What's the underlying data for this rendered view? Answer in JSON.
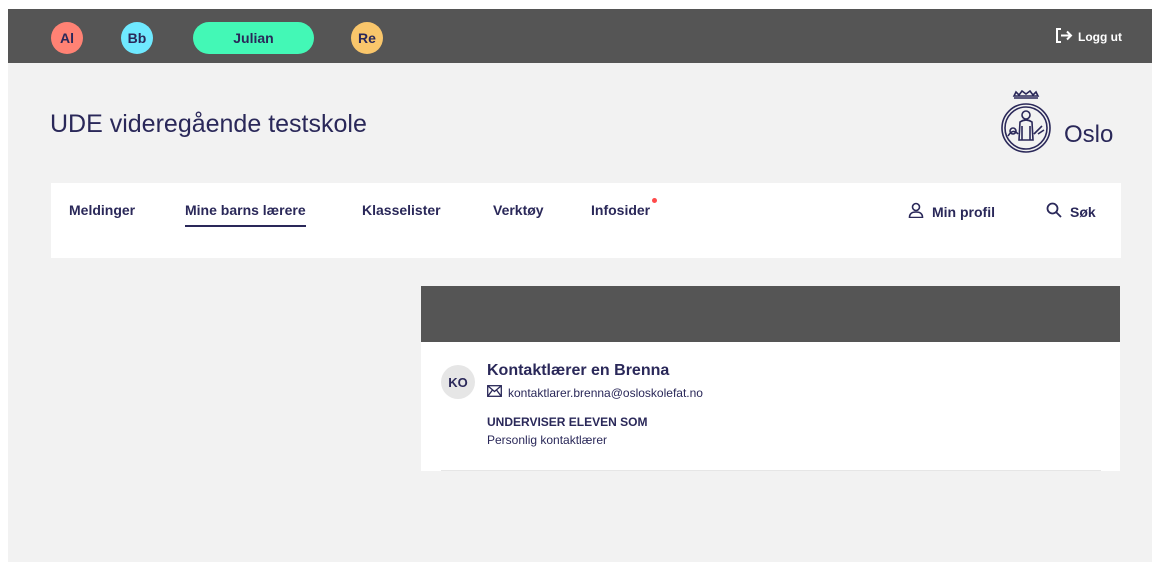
{
  "topbar": {
    "children": [
      {
        "label": "Al",
        "color": "#ff8274"
      },
      {
        "label": "Bb",
        "color": "#6fe9ff"
      },
      {
        "label": "Julian",
        "color": "#43f8b6"
      },
      {
        "label": "Re",
        "color": "#f9c66b"
      }
    ],
    "logout_label": "Logg ut",
    "logout_icon": "logout-icon"
  },
  "header": {
    "title": "UDE videregående testskole",
    "logo_text": "Oslo",
    "logo_icon": "oslo-seal-icon"
  },
  "nav": {
    "items": [
      "Meldinger",
      "Mine barns lærere",
      "Klasselister",
      "Verktøy",
      "Infosider"
    ],
    "active": "Mine barns lærere",
    "profile_label": "Min profil",
    "profile_icon": "user-icon",
    "search_label": "Søk",
    "search_icon": "search-icon"
  },
  "teacher": {
    "initials": "KO",
    "name": "Kontaktlærer en Brenna",
    "email": "kontaktlarer.brenna@osloskolefat.no",
    "email_icon": "envelope-icon",
    "role_heading": "UNDERVISER ELEVEN SOM",
    "role_value": "Personlig kontaktlærer"
  },
  "colors": {
    "topbar": "#555555",
    "page_background": "#f2f2f2",
    "text": "#2a2859",
    "notification_dot": "#ff4a4a"
  }
}
